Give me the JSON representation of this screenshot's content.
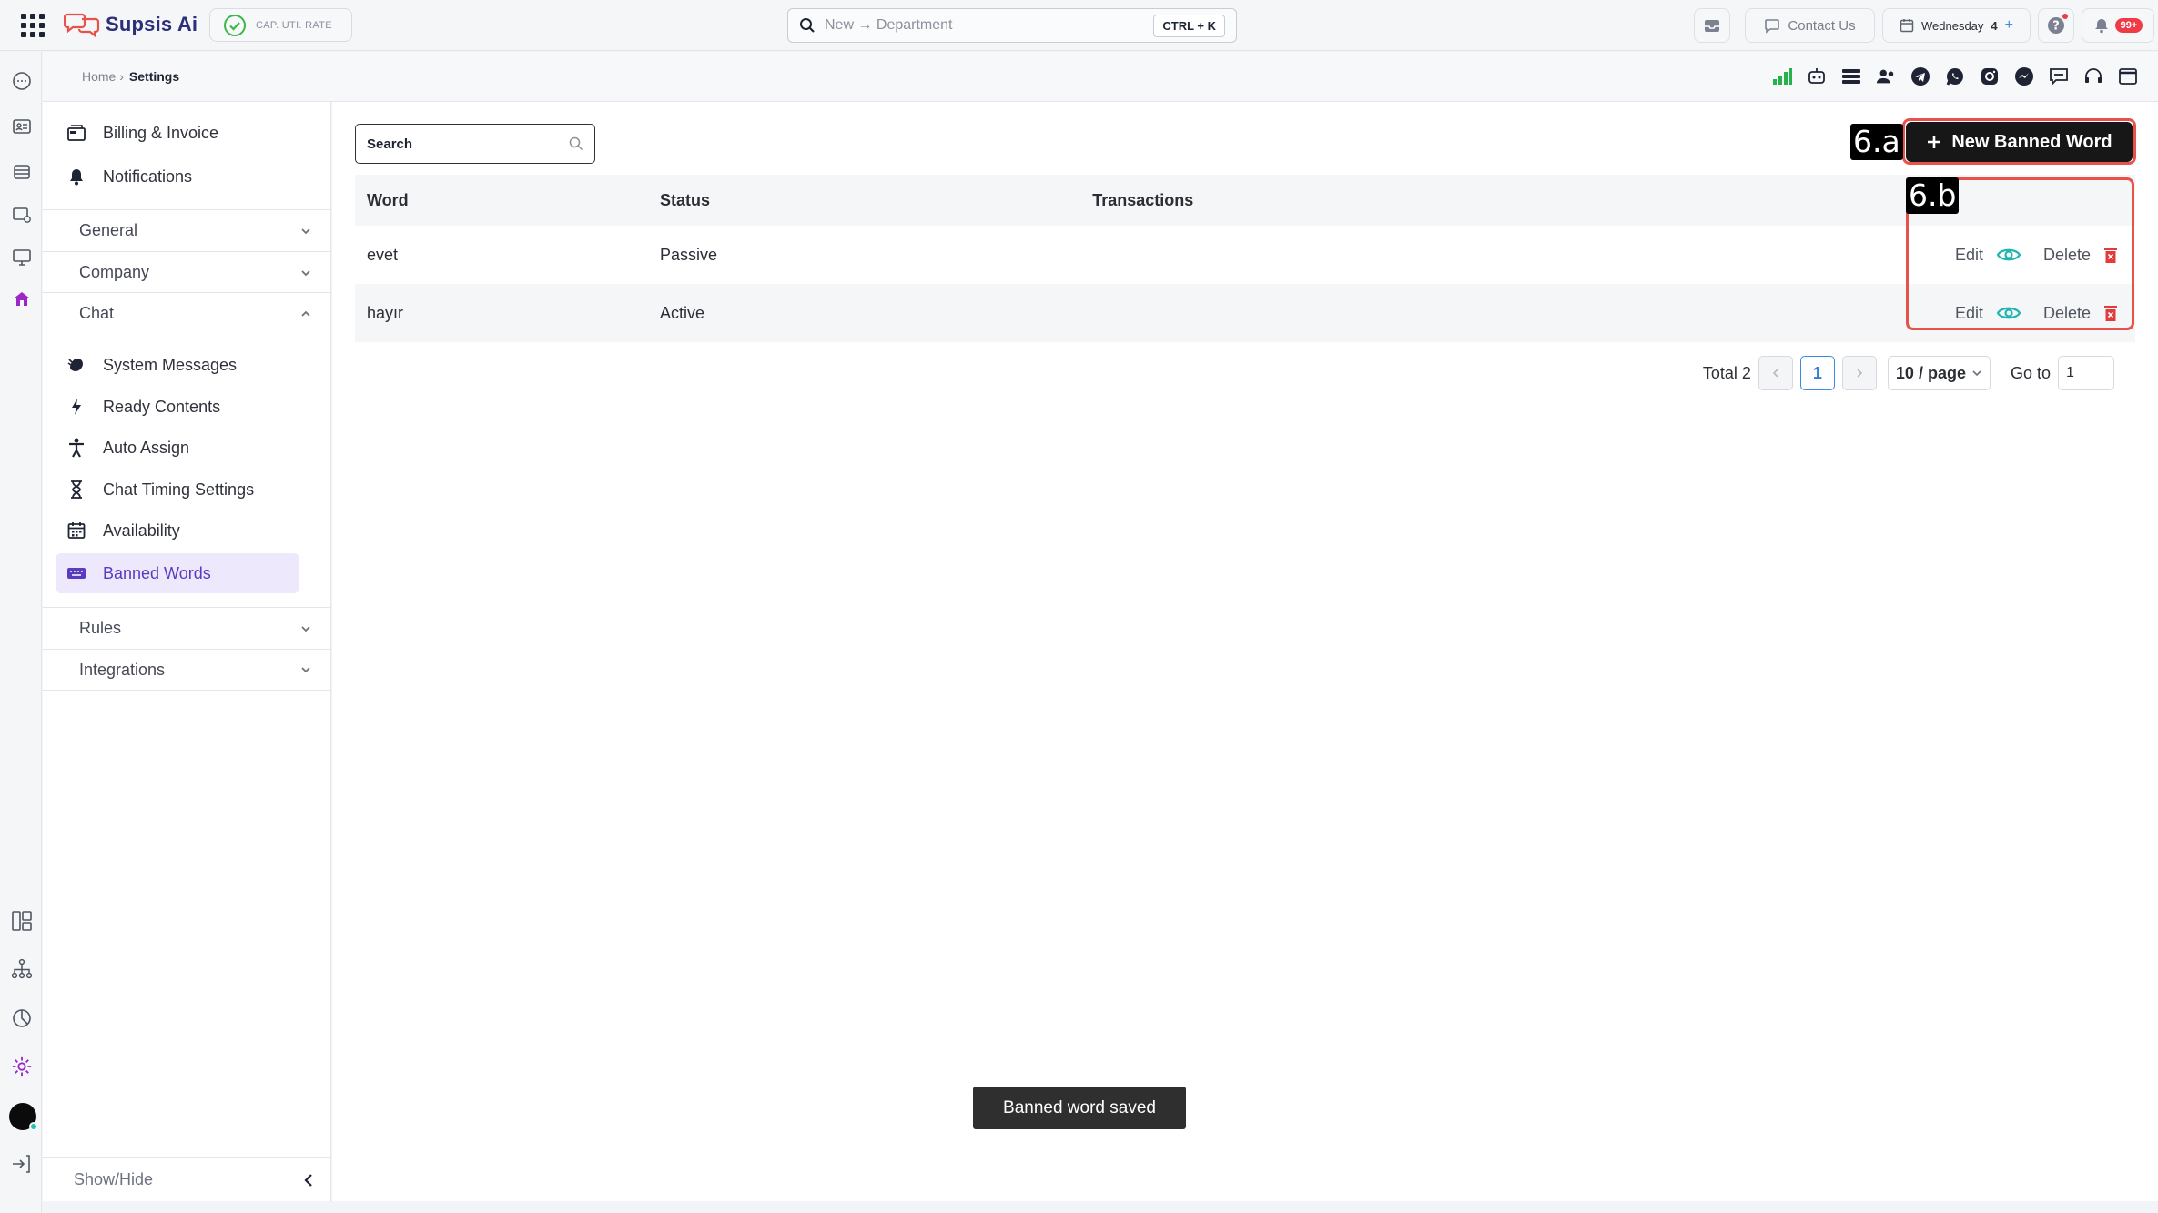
{
  "app": {
    "brand": "Supsis Ai",
    "cap_button": "CAP. UTI. RATE",
    "search_placeholder": "New → Department",
    "search_shortcut": "CTRL + K",
    "contact_label": "Contact Us",
    "date_label": "Wednesday",
    "date_day": "4",
    "notification_badge": "99+"
  },
  "breadcrumb": {
    "home": "Home ›",
    "current": "Settings"
  },
  "sidebar": {
    "top_items": [
      {
        "label": "Billing & Invoice",
        "icon": "billing-icon"
      },
      {
        "label": "Notifications",
        "icon": "bell-icon"
      }
    ],
    "sections": {
      "general": "General",
      "company": "Company",
      "chat": "Chat",
      "rules": "Rules",
      "integrations": "Integrations"
    },
    "chat_items": [
      {
        "label": "System Messages",
        "icon": "wave-icon"
      },
      {
        "label": "Ready Contents",
        "icon": "bolt-icon"
      },
      {
        "label": "Auto Assign",
        "icon": "person-icon"
      },
      {
        "label": "Chat Timing Settings",
        "icon": "hourglass-icon"
      },
      {
        "label": "Availability",
        "icon": "calendar-icon"
      },
      {
        "label": "Banned Words",
        "icon": "keyboard-icon",
        "active": true
      }
    ],
    "show_hide": "Show/Hide"
  },
  "main": {
    "search_placeholder": "Search",
    "new_button": "New Banned Word",
    "annotations": {
      "a": "6.a",
      "b": "6.b"
    },
    "table": {
      "headers": {
        "word": "Word",
        "status": "Status",
        "transactions": "Transactions"
      },
      "rows": [
        {
          "word": "evet",
          "status": "Passive"
        },
        {
          "word": "hayır",
          "status": "Active"
        }
      ],
      "edit_label": "Edit",
      "delete_label": "Delete"
    },
    "pagination": {
      "total": "Total 2",
      "current_page": "1",
      "page_size": "10 / page",
      "goto_label": "Go to",
      "goto_value": "1"
    },
    "toast": "Banned word saved"
  },
  "colors": {
    "accent_purple": "#5a3bc0",
    "annotation_red": "#e8524a",
    "eye_teal": "#1fb5b0",
    "delete_red": "#e23b3b",
    "primary_dark": "#171717"
  }
}
